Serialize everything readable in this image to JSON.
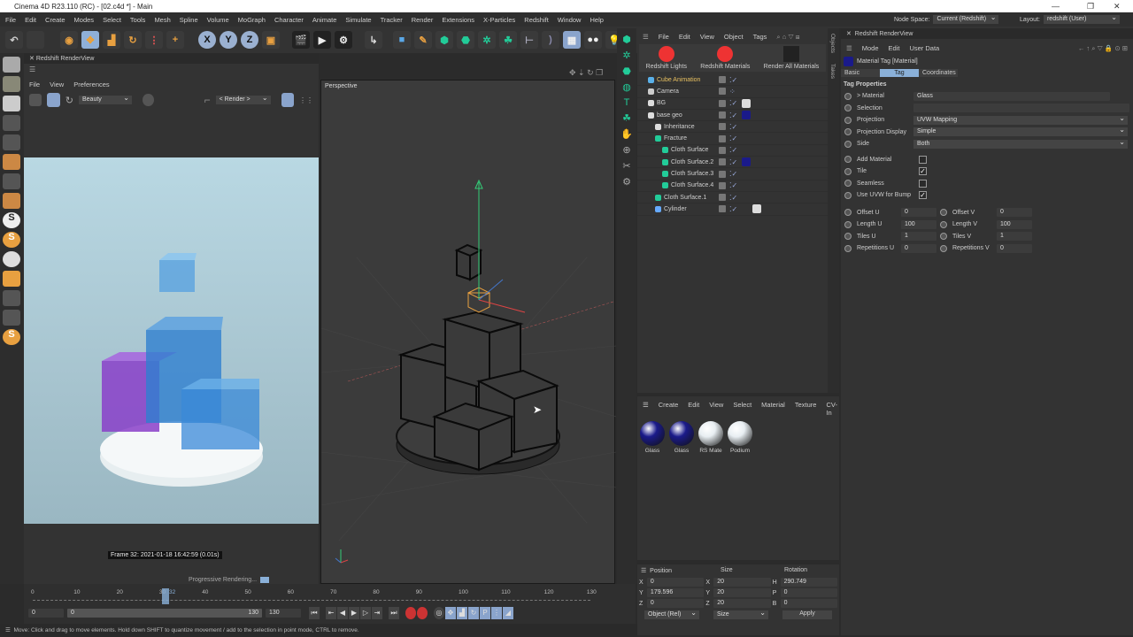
{
  "window": {
    "title": "Cinema 4D R23.110 (RC) - [02.c4d *] - Main",
    "minimize": "—",
    "restore": "❐",
    "close": "✕"
  },
  "menubar": [
    "File",
    "Edit",
    "Create",
    "Modes",
    "Select",
    "Tools",
    "Mesh",
    "Spline",
    "Volume",
    "MoGraph",
    "Character",
    "Animate",
    "Simulate",
    "Tracker",
    "Render",
    "Extensions",
    "X-Particles",
    "Redshift",
    "Window",
    "Help"
  ],
  "toolbar": {
    "axes": [
      "X",
      "Y",
      "Z"
    ],
    "node_space_label": "Node Space:",
    "node_space_value": "Current (Redshift)",
    "layout_label": "Layout:",
    "layout_value": "redshift (User)"
  },
  "renderview": {
    "tab": "Redshift RenderView",
    "menu": [
      "File",
      "View",
      "Preferences"
    ],
    "aov": "Beauty",
    "camera": "< Render >",
    "frame_info": "Frame  32:  2021-01-18  16:42:59  (0.01s)",
    "progress_label": "Progressive Rendering..."
  },
  "viewport": {
    "label": "Perspective"
  },
  "objects": {
    "menu": [
      "File",
      "Edit",
      "View",
      "Object",
      "Tags"
    ],
    "buttons": [
      "Redshift Lights",
      "Redshift Materials",
      "Render All Materials"
    ],
    "side_tabs": [
      "Objects",
      "Takes"
    ],
    "items": [
      {
        "name": "Cube Animation",
        "depth": 0,
        "selected": true
      },
      {
        "name": "Camera",
        "depth": 0
      },
      {
        "name": "BG",
        "depth": 0
      },
      {
        "name": "base geo",
        "depth": 0
      },
      {
        "name": "Inheritance",
        "depth": 1
      },
      {
        "name": "Fracture",
        "depth": 1
      },
      {
        "name": "Cloth Surface",
        "depth": 2
      },
      {
        "name": "Cloth Surface.2",
        "depth": 2
      },
      {
        "name": "Cloth Surface.3",
        "depth": 2
      },
      {
        "name": "Cloth Surface.4",
        "depth": 2
      },
      {
        "name": "Cloth Surface.1",
        "depth": 1
      },
      {
        "name": "Cylinder",
        "depth": 1
      }
    ]
  },
  "materials": {
    "menu": [
      "Create",
      "Edit",
      "View",
      "Select",
      "Material",
      "Texture",
      "CV-In"
    ],
    "items": [
      {
        "name": "Glass",
        "color": "#1a1a8a"
      },
      {
        "name": "Glass",
        "color": "#1a1a8a"
      },
      {
        "name": "RS Mate",
        "color": "#e8eef2"
      },
      {
        "name": "Podium",
        "color": "#e8eef2"
      }
    ]
  },
  "coordinates": {
    "headers": [
      "Position",
      "Size",
      "Rotation"
    ],
    "rows": [
      {
        "pl": "X",
        "pv": "0",
        "sl": "X",
        "sv": "20",
        "rl": "H",
        "rv": "290.749"
      },
      {
        "pl": "Y",
        "pv": "179.596",
        "sl": "Y",
        "sv": "20",
        "rl": "P",
        "rv": "0"
      },
      {
        "pl": "Z",
        "pv": "0",
        "sl": "Z",
        "sv": "20",
        "rl": "B",
        "rv": "0"
      }
    ],
    "mode": "Object (Rel)",
    "size_mode": "Size",
    "apply": "Apply"
  },
  "attributes": {
    "tab": "Redshift RenderView",
    "menu": [
      "Mode",
      "Edit",
      "User Data"
    ],
    "title": "Material Tag [Material]",
    "tabs": [
      "Basic",
      "Tag",
      "Coordinates"
    ],
    "active_tab": "Tag",
    "section": "Tag Properties",
    "material_label": "> Material",
    "material_value": "Glass",
    "selection_label": "Selection",
    "dropdowns": [
      {
        "label": "Projection",
        "value": "UVW Mapping"
      },
      {
        "label": "Projection Display",
        "value": "Simple"
      },
      {
        "label": "Side",
        "value": "Both"
      }
    ],
    "checks": [
      {
        "label": "Add Material",
        "checked": false
      },
      {
        "label": "Tile",
        "checked": true
      },
      {
        "label": "Seamless",
        "checked": false
      },
      {
        "label": "Use UVW for Bump",
        "checked": true
      }
    ],
    "pairs": [
      {
        "l1": "Offset U",
        "v1": "0",
        "l2": "Offset V",
        "v2": "0"
      },
      {
        "l1": "Length U",
        "v1": "100",
        "l2": "Length V",
        "v2": "100"
      },
      {
        "l1": "Tiles U",
        "v1": "1",
        "l2": "Tiles V",
        "v2": "1"
      },
      {
        "l1": "Repetitions U",
        "v1": "0",
        "l2": "Repetitions V",
        "v2": "0"
      }
    ]
  },
  "timeline": {
    "ticks": [
      "0",
      "10",
      "20",
      "30",
      "40",
      "50",
      "60",
      "70",
      "80",
      "90",
      "100",
      "110",
      "120",
      "130"
    ],
    "current_frame": "32",
    "start": "0",
    "range_start": "0",
    "range_end": "130",
    "end": "130"
  },
  "status": "Move: Click and drag to move elements. Hold down SHIFT to quantize movement / add to the selection in point mode, CTRL to remove."
}
